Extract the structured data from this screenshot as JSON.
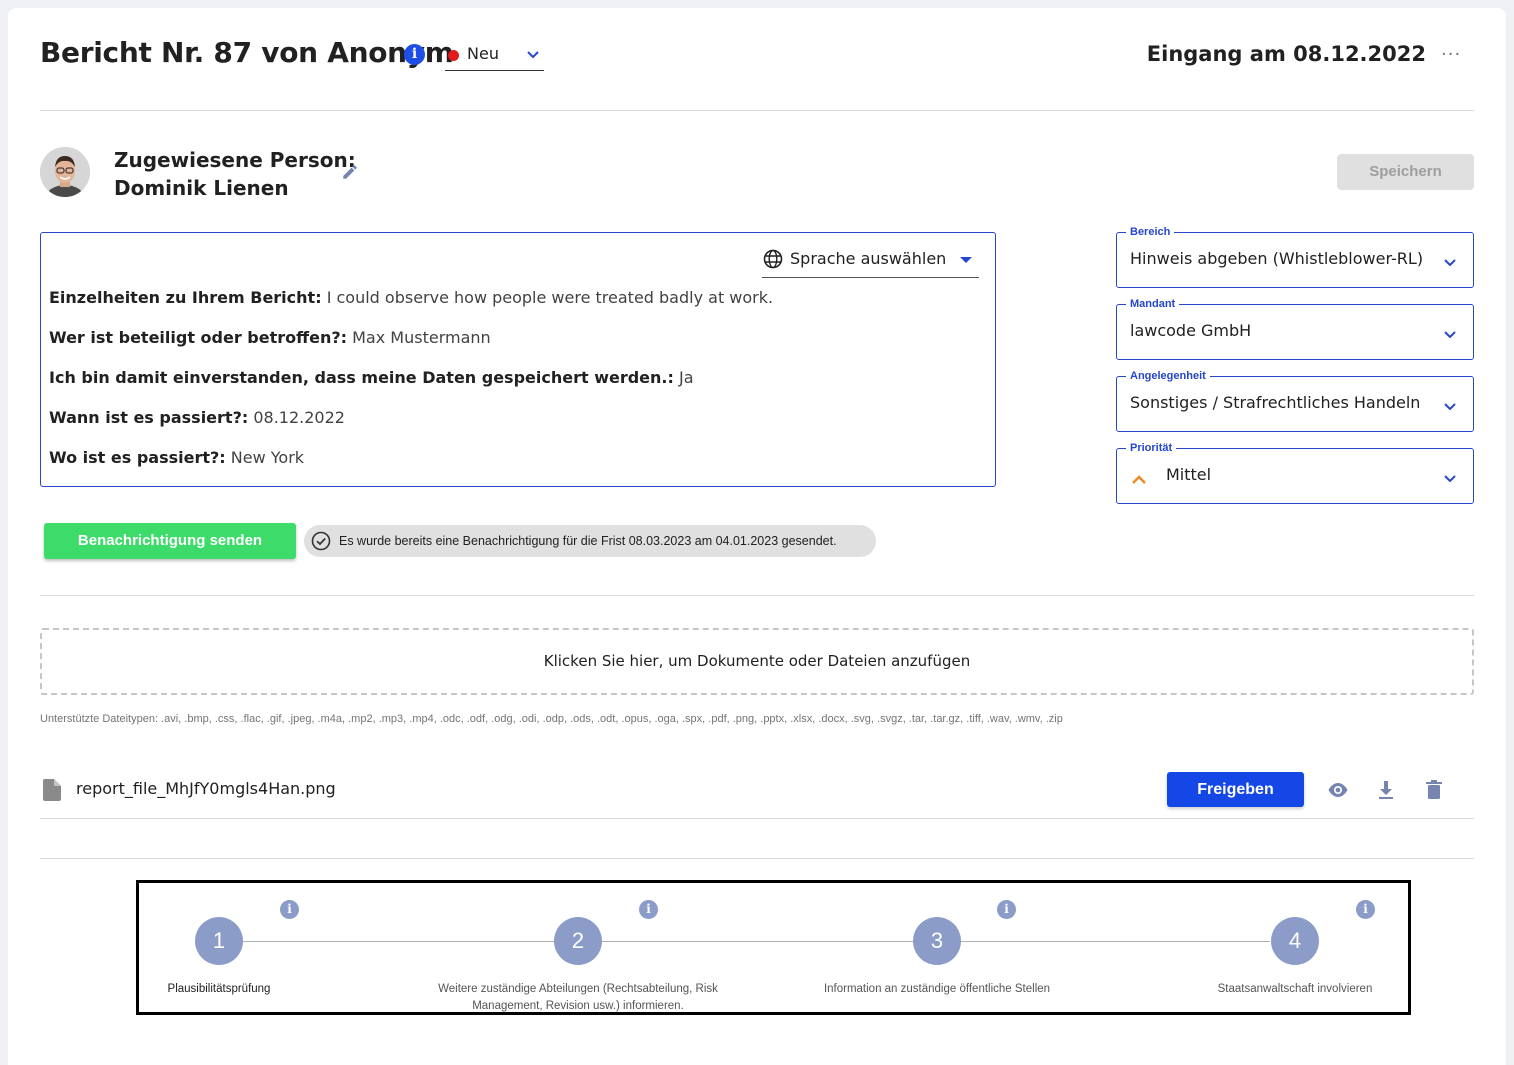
{
  "header": {
    "title": "Bericht Nr. 87 von Anonym",
    "status": "Neu",
    "received": "Eingang am 08.12.2022",
    "more": "···"
  },
  "assignee": {
    "label": "Zugewiesene Person:",
    "name": "Dominik Lienen",
    "save_label": "Speichern"
  },
  "report": {
    "language_placeholder": "Sprache auswählen",
    "fields": [
      {
        "label": "Einzelheiten zu Ihrem Bericht:",
        "value": "I could observe how people were treated badly at work."
      },
      {
        "label": "Wer ist beteiligt oder betroffen?:",
        "value": "Max Mustermann"
      },
      {
        "label": "Ich bin damit einverstanden, dass meine Daten gespeichert werden.:",
        "value": "Ja"
      },
      {
        "label": "Wann ist es passiert?:",
        "value": "08.12.2022"
      },
      {
        "label": "Wo ist es passiert?:",
        "value": "New York"
      }
    ]
  },
  "selects": {
    "bereich": {
      "legend": "Bereich",
      "value": "Hinweis abgeben (Whistleblower-RL)"
    },
    "mandant": {
      "legend": "Mandant",
      "value": "lawcode GmbH"
    },
    "angelegenheit": {
      "legend": "Angelegenheit",
      "value": "Sonstiges / Strafrechtliches Handeln"
    },
    "prioritaet": {
      "legend": "Priorität",
      "value": "Mittel"
    }
  },
  "notification": {
    "button": "Benachrichtigung senden",
    "info": "Es wurde bereits eine Benachrichtigung für die Frist 08.03.2023 am 04.01.2023 gesendet."
  },
  "upload": {
    "dropzone": "Klicken Sie hier, um Dokumente oder Dateien anzufügen",
    "types": "Unterstützte Dateitypen: .avi, .bmp, .css, .flac, .gif, .jpeg, .m4a, .mp2, .mp3, .mp4, .odc, .odf, .odg, .odi, .odp, .ods, .odt, .opus, .oga, .spx, .pdf, .png, .pptx, .xlsx, .docx, .svg, .svgz, .tar, .tar.gz, .tiff, .wav, .wmv, .zip"
  },
  "file": {
    "name": "report_file_MhJfY0mgls4Han.png",
    "release_button": "Freigeben"
  },
  "steps": [
    {
      "number": "1",
      "label": "Plausibilitätsprüfung"
    },
    {
      "number": "2",
      "label": "Weitere zuständige Abteilungen (Rechtsabteilung, Risk Management, Revision usw.) informieren."
    },
    {
      "number": "3",
      "label": "Information an zuständige öffentliche Stellen"
    },
    {
      "number": "4",
      "label": "Staatsanwaltschaft involvieren"
    }
  ],
  "colors": {
    "primary": "#1447e6",
    "success": "#3ddc6a",
    "status_new": "#e31b1b",
    "step": "#8b9cc8",
    "priority_medium": "#f08a24"
  }
}
